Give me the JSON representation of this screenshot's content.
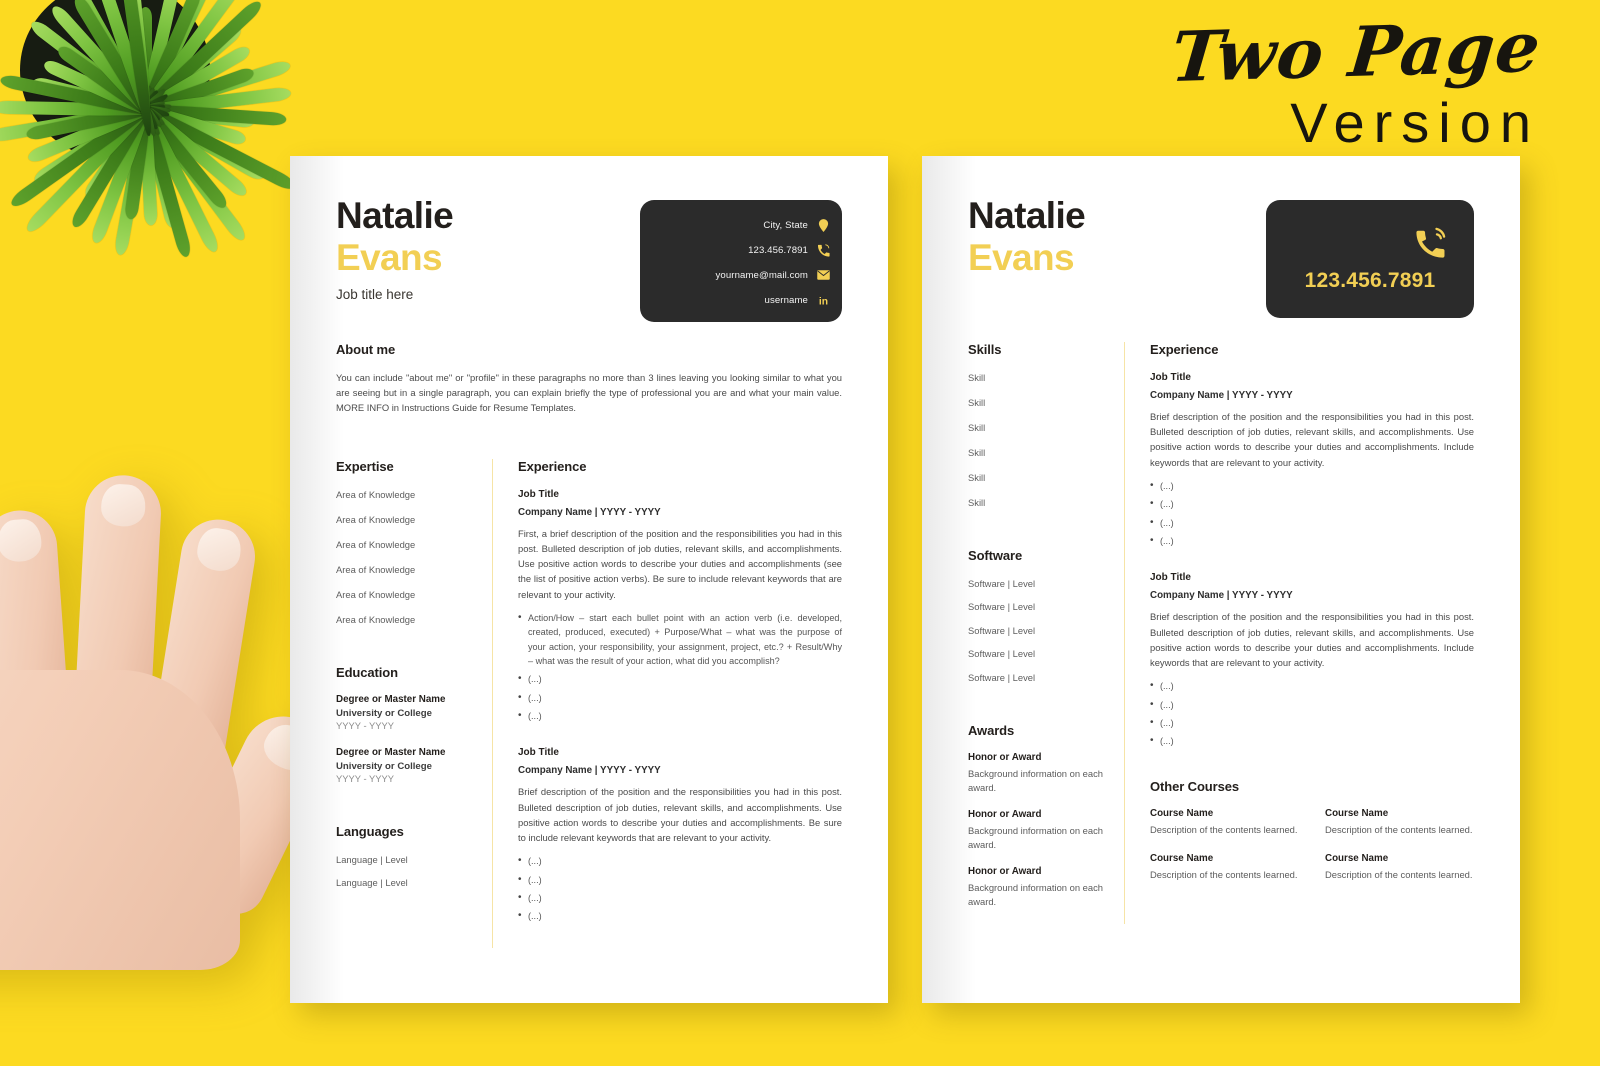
{
  "promo": {
    "line1": "Two Page",
    "line2": "Version"
  },
  "theme": {
    "background_yellow": "#FCDA21",
    "accent_yellow": "#F2CF54",
    "card_dark": "#2B2B2B",
    "page_white": "#FFFFFF",
    "divider_yellow": "#F6E4A6"
  },
  "page1": {
    "first_name": "Natalie",
    "last_name": "Evans",
    "job_title": "Job title here",
    "contact": [
      {
        "icon": "location-pin-icon",
        "text": "City, State"
      },
      {
        "icon": "phone-icon",
        "text": "123.456.7891"
      },
      {
        "icon": "envelope-icon",
        "text": "yourname@mail.com"
      },
      {
        "icon": "linkedin-icon",
        "text": "username"
      }
    ],
    "about": {
      "heading": "About me",
      "text": "You can include \"about me\" or \"profile\" in these paragraphs no more than 3 lines leaving you looking similar to what you are seeing but in a single paragraph, you can explain briefly the type of professional you are and what your main value. MORE INFO in Instructions Guide for Resume Templates."
    },
    "expertise": {
      "heading": "Expertise",
      "items": [
        "Area of Knowledge",
        "Area of Knowledge",
        "Area of Knowledge",
        "Area of Knowledge",
        "Area of Knowledge",
        "Area of Knowledge"
      ]
    },
    "education": {
      "heading": "Education",
      "items": [
        {
          "degree": "Degree or Master Name",
          "school": "University or College",
          "years": "YYYY - YYYY"
        },
        {
          "degree": "Degree or Master Name",
          "school": "University or College",
          "years": "YYYY - YYYY"
        }
      ]
    },
    "languages": {
      "heading": "Languages",
      "items": [
        "Language  |  Level",
        "Language  |  Level"
      ]
    },
    "experience": {
      "heading": "Experience",
      "jobs": [
        {
          "title": "Job Title",
          "company": "Company Name  |  YYYY - YYYY",
          "description": "First, a brief description of the position and the responsibilities you had in this post. Bulleted description of job duties, relevant skills, and accomplishments. Use positive action words to describe your duties and accomplishments (see the list of positive action verbs). Be sure to include relevant keywords that are relevant to your activity.",
          "bullets": [
            "Action/How – start each bullet point with an action verb (i.e. developed, created, produced, executed) + Purpose/What – what was the purpose of your action, your responsibility, your assignment, project, etc.? + Result/Why – what was the result of your action, what did you accomplish?",
            "(...)",
            "(...)",
            "(...)"
          ]
        },
        {
          "title": "Job Title",
          "company": "Company Name  |  YYYY - YYYY",
          "description": "Brief description of the position and the responsibilities you had in this post. Bulleted description of job duties, relevant skills, and accomplishments. Use positive action words to describe your duties and accomplishments. Be sure to include relevant keywords that are relevant to your activity.",
          "bullets": [
            "(...)",
            "(...)",
            "(...)",
            "(...)"
          ]
        }
      ]
    }
  },
  "page2": {
    "first_name": "Natalie",
    "last_name": "Evans",
    "phone_icon": "phone-ringing-icon",
    "phone": "123.456.7891",
    "skills": {
      "heading": "Skills",
      "items": [
        "Skill",
        "Skill",
        "Skill",
        "Skill",
        "Skill",
        "Skill"
      ]
    },
    "software": {
      "heading": "Software",
      "items": [
        "Software  |  Level",
        "Software  |  Level",
        "Software  |  Level",
        "Software  |  Level",
        "Software  |  Level"
      ]
    },
    "awards": {
      "heading": "Awards",
      "items": [
        {
          "title": "Honor or Award",
          "body": "Background information on each award."
        },
        {
          "title": "Honor or Award",
          "body": "Background information on each award."
        },
        {
          "title": "Honor or Award",
          "body": "Background information on each award."
        }
      ]
    },
    "experience": {
      "heading": "Experience",
      "jobs": [
        {
          "title": "Job Title",
          "company": "Company Name  |  YYYY - YYYY",
          "description": "Brief description of the position and the responsibilities you had in this post. Bulleted description of job duties, relevant skills, and accomplishments. Use positive action words to describe your duties and accomplishments. Include keywords that are relevant to your activity.",
          "bullets": [
            "(...)",
            "(...)",
            "(...)",
            "(...)"
          ]
        },
        {
          "title": "Job Title",
          "company": "Company Name  |  YYYY - YYYY",
          "description": "Brief description of the position and the responsibilities you had in this post. Bulleted description of job duties, relevant skills, and accomplishments. Use positive action words to describe your duties and accomplishments. Include keywords that are relevant to your activity.",
          "bullets": [
            "(...)",
            "(...)",
            "(...)",
            "(...)"
          ]
        }
      ]
    },
    "other_courses": {
      "heading": "Other Courses",
      "items": [
        {
          "name": "Course Name",
          "desc": "Description of the contents learned."
        },
        {
          "name": "Course Name",
          "desc": "Description of the contents learned."
        },
        {
          "name": "Course Name",
          "desc": "Description of the contents learned."
        },
        {
          "name": "Course Name",
          "desc": "Description of the contents learned."
        }
      ]
    }
  }
}
